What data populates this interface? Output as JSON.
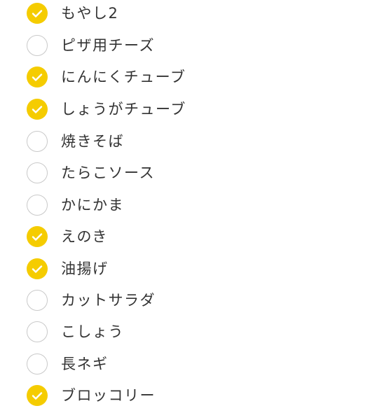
{
  "colors": {
    "accent": "#f5cc00",
    "unchecked_border": "#c9c9c9",
    "text": "#333333",
    "checkmark": "#ffffff"
  },
  "items": [
    {
      "label": "もやし2",
      "checked": true
    },
    {
      "label": "ピザ用チーズ",
      "checked": false
    },
    {
      "label": "にんにくチューブ",
      "checked": true
    },
    {
      "label": "しょうがチューブ",
      "checked": true
    },
    {
      "label": "焼きそば",
      "checked": false
    },
    {
      "label": "たらこソース",
      "checked": false
    },
    {
      "label": "かにかま",
      "checked": false
    },
    {
      "label": "えのき",
      "checked": true
    },
    {
      "label": "油揚げ",
      "checked": true
    },
    {
      "label": "カットサラダ",
      "checked": false
    },
    {
      "label": "こしょう",
      "checked": false
    },
    {
      "label": "長ネギ",
      "checked": false
    },
    {
      "label": "ブロッコリー",
      "checked": true
    }
  ]
}
